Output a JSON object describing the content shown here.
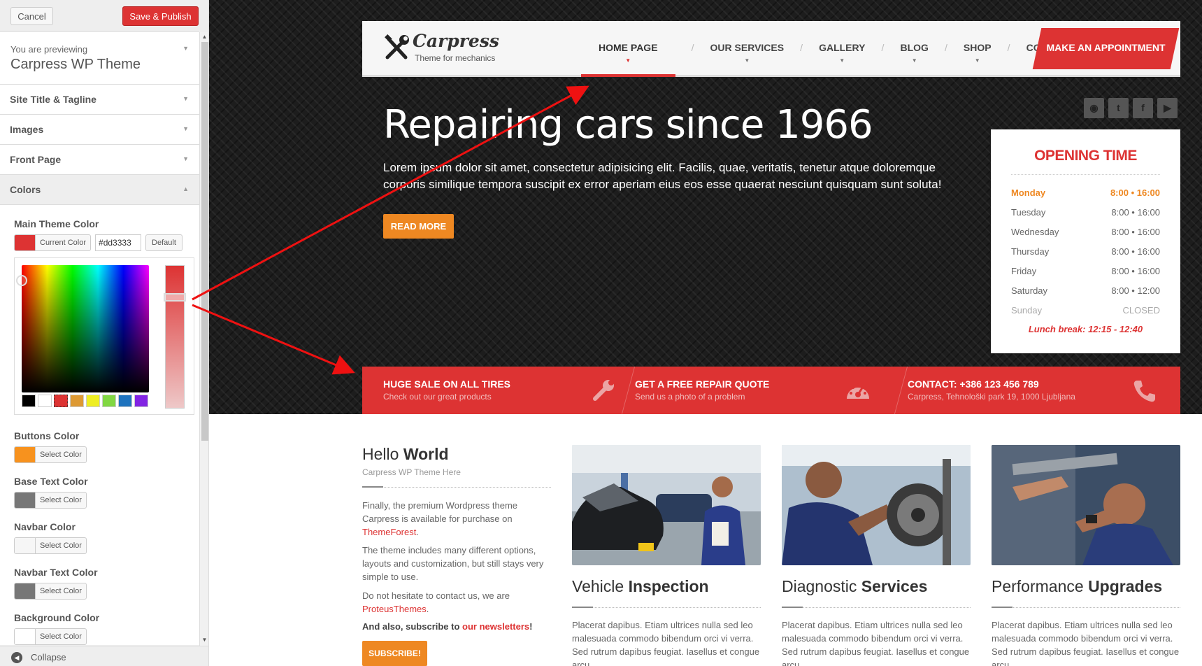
{
  "customizer": {
    "cancel_label": "Cancel",
    "publish_label": "Save & Publish",
    "preview_small": "You are previewing",
    "preview_theme": "Carpress WP Theme",
    "sections": [
      {
        "label": "Site Title & Tagline"
      },
      {
        "label": "Images"
      },
      {
        "label": "Front Page"
      },
      {
        "label": "Colors"
      }
    ],
    "main_color": {
      "label": "Main Theme Color",
      "button_label": "Current Color",
      "hex_value": "#dd3333",
      "default_label": "Default",
      "swatch": "#dd3333"
    },
    "palette": [
      "#000000",
      "#ffffff",
      "#dd3333",
      "#dd9933",
      "#eeee22",
      "#81d742",
      "#1e73be",
      "#8224e3"
    ],
    "colors": [
      {
        "label": "Buttons Color",
        "button_label": "Select Color",
        "swatch": "#f7921e"
      },
      {
        "label": "Base Text Color",
        "button_label": "Select Color",
        "swatch": "#777777"
      },
      {
        "label": "Navbar Color",
        "button_label": "Select Color",
        "swatch": "#f6f6f6"
      },
      {
        "label": "Navbar Text Color",
        "button_label": "Select Color",
        "swatch": "#777777"
      },
      {
        "label": "Background Color",
        "button_label": "Select Color",
        "swatch": "#ffffff"
      }
    ],
    "collapse_label": "Collapse"
  },
  "site": {
    "logo_name": "Carpress",
    "logo_tagline": "Theme for mechanics",
    "menu": [
      {
        "label": "HOME PAGE"
      },
      {
        "label": "OUR SERVICES"
      },
      {
        "label": "GALLERY"
      },
      {
        "label": "BLOG"
      },
      {
        "label": "SHOP"
      },
      {
        "label": "CONTACT US"
      }
    ],
    "appointment_label": "MAKE AN APPOINTMENT",
    "hero_title": "Repairing cars since 1966",
    "hero_text": "Lorem ipsum dolor sit amet, consectetur adipisicing elit. Facilis, quae, veritatis, tenetur atque doloremque corporis similique tempora suscipit ex error aperiam eius eos esse quaerat nesciunt quisquam sunt soluta!",
    "read_more_label": "READ MORE",
    "socials": [
      "rss-icon",
      "twitter-icon",
      "facebook-icon",
      "youtube-icon"
    ],
    "opening": {
      "title": "OPENING TIME",
      "rows": [
        {
          "day": "Monday",
          "hours": "8:00 • 16:00"
        },
        {
          "day": "Tuesday",
          "hours": "8:00 • 16:00"
        },
        {
          "day": "Wednesday",
          "hours": "8:00 • 16:00"
        },
        {
          "day": "Thursday",
          "hours": "8:00 • 16:00"
        },
        {
          "day": "Friday",
          "hours": "8:00 • 16:00"
        },
        {
          "day": "Saturday",
          "hours": "8:00 • 12:00"
        },
        {
          "day": "Sunday",
          "hours": "CLOSED"
        }
      ],
      "lunch": "Lunch break: 12:15 - 12:40"
    },
    "bar": [
      {
        "title": "HUGE SALE ON ALL TIRES",
        "sub": "Check out our great products",
        "icon": "wrench-icon"
      },
      {
        "title": "GET A FREE REPAIR QUOTE",
        "sub": "Send us a photo of a problem",
        "icon": "gauge-icon"
      },
      {
        "title": "CONTACT: +386 123 456 789",
        "sub": "Carpress, Tehnološki park 19, 1000 Ljubljana",
        "icon": "phone-icon"
      }
    ],
    "hello": {
      "light": "Hello",
      "bold": "World",
      "sub": "Carpress WP Theme Here",
      "p1_a": "Finally, the premium Wordpress theme Carpress is available for purchase on",
      "p1_link": "ThemeForest",
      "p1_end": ".",
      "p2": "The theme includes many different options, layouts and customization, but still stays very simple to use.",
      "p3_a": "Do not hesitate to contact us, we are",
      "p3_link": "ProteusThemes",
      "p3_end": ".",
      "subscribe_a": "And also, subscribe to",
      "subscribe_link": "our newsletters",
      "subscribe_end": "!",
      "subscribe_btn": "SUBSCRIBE!"
    },
    "cards": [
      {
        "light": "Vehicle",
        "bold": "Inspection",
        "text": "Placerat dapibus. Etiam ultrices nulla sed leo malesuada commodo bibendum orci vi verra. Sed rutrum dapibus feugiat. Iasellus et congue arcu."
      },
      {
        "light": "Diagnostic",
        "bold": "Services",
        "text": "Placerat dapibus. Etiam ultrices nulla sed leo malesuada commodo bibendum orci vi verra. Sed rutrum dapibus feugiat. Iasellus et congue arcu."
      },
      {
        "light": "Performance",
        "bold": "Upgrades",
        "text": "Placerat dapibus. Etiam ultrices nulla sed leo malesuada commodo bibendum orci vi verra. Sed rutrum dapibus feugiat. Iasellus et congue arcu."
      }
    ]
  }
}
